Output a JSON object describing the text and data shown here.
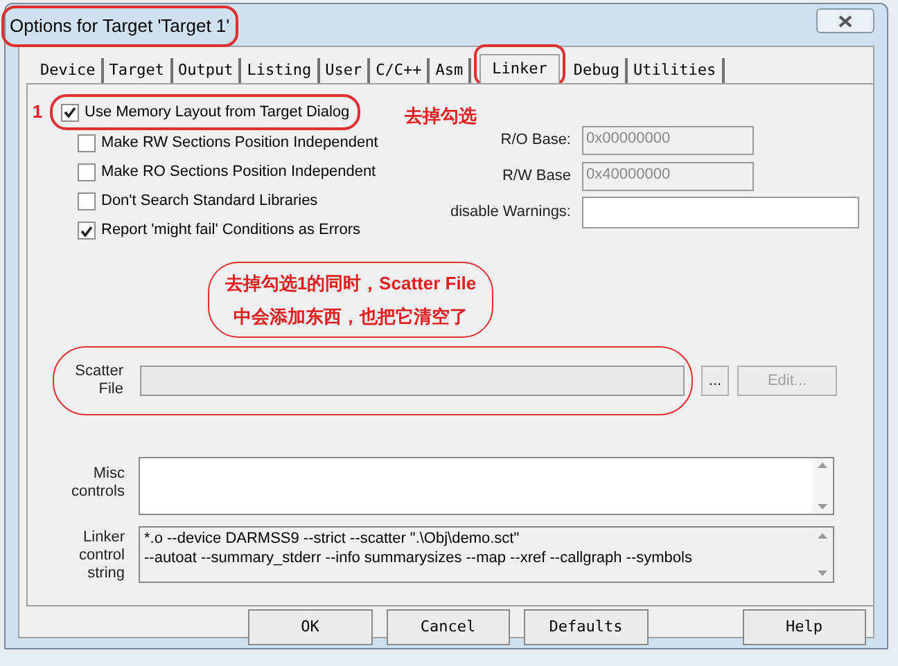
{
  "window": {
    "title": "Options for Target 'Target 1'"
  },
  "tabs": [
    {
      "label": "Device",
      "selected": false
    },
    {
      "label": "Target",
      "selected": false
    },
    {
      "label": "Output",
      "selected": false
    },
    {
      "label": "Listing",
      "selected": false
    },
    {
      "label": "User",
      "selected": false
    },
    {
      "label": "C/C++",
      "selected": false
    },
    {
      "label": "Asm",
      "selected": false
    },
    {
      "label": "Linker",
      "selected": true,
      "circled": true
    },
    {
      "label": "Debug",
      "selected": false
    },
    {
      "label": "Utilities",
      "selected": false
    }
  ],
  "memory_layout_option": {
    "label": "Use Memory Layout from Target Dialog",
    "checked": true
  },
  "options": [
    {
      "label": "Make RW Sections Position Independent",
      "checked": false
    },
    {
      "label": "Make RO Sections Position Independent",
      "checked": false
    },
    {
      "label": "Don't Search Standard Libraries",
      "checked": false
    },
    {
      "label": "Report 'might fail' Conditions as Errors",
      "checked": true
    }
  ],
  "fields": [
    {
      "label": "R/O Base:",
      "value": "0x00000000",
      "disabled": true
    },
    {
      "label": "R/W Base",
      "value": "0x40000000",
      "disabled": true
    },
    {
      "label": "disable Warnings:",
      "disabled": false
    }
  ],
  "scatter_file": {
    "label": "Scatter File",
    "disabled": true,
    "browse_button": "...",
    "edit_button": "Edit..."
  },
  "misc_controls": {
    "label": "Misc controls"
  },
  "linker_control_string": {
    "label": "Linker control string",
    "lines": [
      "*.o --device DARMSS9 --strict --scatter \".\\Obj\\demo.sct\"",
      "--autoat --summary_stderr --info summarysizes --map --xref --callgraph --symbols"
    ]
  },
  "buttons": [
    "OK",
    "Cancel",
    "Defaults",
    "Help"
  ],
  "annotations": {
    "marker": "1",
    "note": "去掉勾选",
    "callout_lines": [
      "去掉勾选1的同时，Scatter File",
      "中会添加东西，也把它清空了"
    ]
  }
}
